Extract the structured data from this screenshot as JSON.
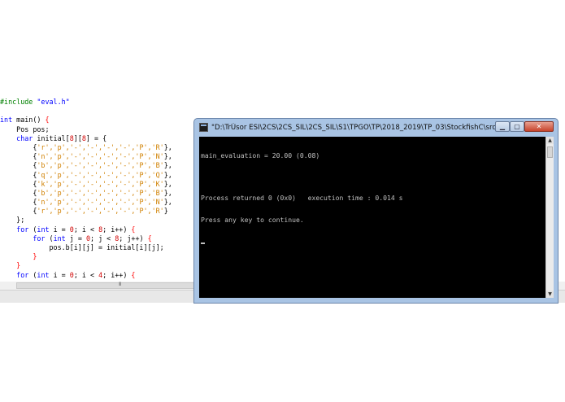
{
  "editor": {
    "lines": [
      [
        {
          "t": "#include ",
          "c": "prep"
        },
        {
          "t": "\"eval.h\"",
          "c": "str"
        }
      ],
      [],
      [
        {
          "t": "int",
          "c": "kw"
        },
        {
          "t": " main() ",
          "c": "plain"
        },
        {
          "t": "{",
          "c": "punc"
        }
      ],
      [
        {
          "t": "    Pos pos;",
          "c": "plain"
        }
      ],
      [
        {
          "t": "    ",
          "c": "plain"
        },
        {
          "t": "char",
          "c": "kw"
        },
        {
          "t": " initial[",
          "c": "plain"
        },
        {
          "t": "8",
          "c": "num"
        },
        {
          "t": "][",
          "c": "plain"
        },
        {
          "t": "8",
          "c": "num"
        },
        {
          "t": "] = {",
          "c": "plain"
        }
      ],
      [
        {
          "t": "        {",
          "c": "plain"
        },
        {
          "t": "'r','p','-','-','-','-','P','R'",
          "c": "chr"
        },
        {
          "t": "},",
          "c": "plain"
        }
      ],
      [
        {
          "t": "        {",
          "c": "plain"
        },
        {
          "t": "'n','p','-','-','-','-','P','N'",
          "c": "chr"
        },
        {
          "t": "},",
          "c": "plain"
        }
      ],
      [
        {
          "t": "        {",
          "c": "plain"
        },
        {
          "t": "'b','p','-','-','-','-','P','B'",
          "c": "chr"
        },
        {
          "t": "},",
          "c": "plain"
        }
      ],
      [
        {
          "t": "        {",
          "c": "plain"
        },
        {
          "t": "'q','p','-','-','-','-','P','Q'",
          "c": "chr"
        },
        {
          "t": "},",
          "c": "plain"
        }
      ],
      [
        {
          "t": "        {",
          "c": "plain"
        },
        {
          "t": "'k','p','-','-','-','-','P','K'",
          "c": "chr"
        },
        {
          "t": "},",
          "c": "plain"
        }
      ],
      [
        {
          "t": "        {",
          "c": "plain"
        },
        {
          "t": "'b','p','-','-','-','-','P','B'",
          "c": "chr"
        },
        {
          "t": "},",
          "c": "plain"
        }
      ],
      [
        {
          "t": "        {",
          "c": "plain"
        },
        {
          "t": "'n','p','-','-','-','-','P','N'",
          "c": "chr"
        },
        {
          "t": "},",
          "c": "plain"
        }
      ],
      [
        {
          "t": "        {",
          "c": "plain"
        },
        {
          "t": "'r','p','-','-','-','-','P','R'",
          "c": "chr"
        },
        {
          "t": "}",
          "c": "plain"
        }
      ],
      [
        {
          "t": "    };",
          "c": "plain"
        }
      ],
      [
        {
          "t": "    ",
          "c": "plain"
        },
        {
          "t": "for",
          "c": "kw"
        },
        {
          "t": " (",
          "c": "plain"
        },
        {
          "t": "int",
          "c": "kw"
        },
        {
          "t": " i = ",
          "c": "plain"
        },
        {
          "t": "0",
          "c": "num"
        },
        {
          "t": "; i < ",
          "c": "plain"
        },
        {
          "t": "8",
          "c": "num"
        },
        {
          "t": "; i++) ",
          "c": "plain"
        },
        {
          "t": "{",
          "c": "punc"
        }
      ],
      [
        {
          "t": "        ",
          "c": "plain"
        },
        {
          "t": "for",
          "c": "kw"
        },
        {
          "t": " (",
          "c": "plain"
        },
        {
          "t": "int",
          "c": "kw"
        },
        {
          "t": " j = ",
          "c": "plain"
        },
        {
          "t": "0",
          "c": "num"
        },
        {
          "t": "; j < ",
          "c": "plain"
        },
        {
          "t": "8",
          "c": "num"
        },
        {
          "t": "; j++) ",
          "c": "plain"
        },
        {
          "t": "{",
          "c": "punc"
        }
      ],
      [
        {
          "t": "            pos.b[i][j] = initial[i][j];",
          "c": "plain"
        }
      ],
      [
        {
          "t": "        ",
          "c": "plain"
        },
        {
          "t": "}",
          "c": "punc"
        }
      ],
      [
        {
          "t": "    ",
          "c": "plain"
        },
        {
          "t": "}",
          "c": "punc"
        }
      ],
      [
        {
          "t": "    ",
          "c": "plain"
        },
        {
          "t": "for",
          "c": "kw"
        },
        {
          "t": " (",
          "c": "plain"
        },
        {
          "t": "int",
          "c": "kw"
        },
        {
          "t": " i = ",
          "c": "plain"
        },
        {
          "t": "0",
          "c": "num"
        },
        {
          "t": "; i < ",
          "c": "plain"
        },
        {
          "t": "4",
          "c": "num"
        },
        {
          "t": "; i++) ",
          "c": "plain"
        },
        {
          "t": "{",
          "c": "punc"
        }
      ]
    ],
    "scroll_grip": "III"
  },
  "console": {
    "title": "\"D:\\TrÚsor ESI\\2CS\\2CS_SIL\\2CS_SIL\\S1\\TPGO\\TP\\2018_2019\\TP_03\\StockfishC\\src\\bin\\Debug\\Sto...",
    "buttons": {
      "minimize": "▁",
      "maximize": "▢",
      "close": "✕"
    },
    "output_lines": [
      "main_evaluation = 20.00 (0.08)",
      "",
      "Process returned 0 (0x0)   execution time : 0.014 s",
      "Press any key to continue."
    ],
    "scroll_up": "▲",
    "scroll_down": "▼"
  },
  "colors": {
    "terminal_bg": "#000000",
    "terminal_fg": "#c0c0c0",
    "window_frame": "#a9c4e4",
    "close_button": "#c8442c"
  }
}
